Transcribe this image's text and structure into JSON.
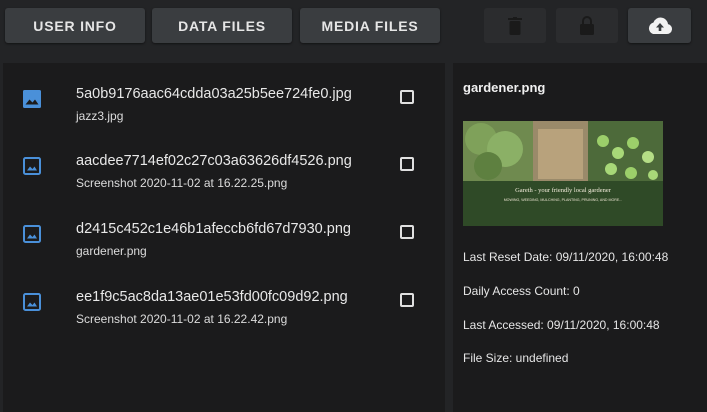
{
  "toolbar": {
    "user_info_label": "USER INFO",
    "data_files_label": "DATA FILES",
    "media_files_label": "MEDIA FILES",
    "delete_icon": "trash-icon",
    "lock_icon": "lock-icon",
    "upload_icon": "cloud-upload-icon"
  },
  "files": [
    {
      "hash": "5a0b9176aac64cdda03a25b5ee724fe0.jpg",
      "name": "jazz3.jpg",
      "icon": "image-icon",
      "icon_style": "filled"
    },
    {
      "hash": "aacdee7714ef02c27c03a63626df4526.png",
      "name": "Screenshot 2020-11-02 at 16.22.25.png",
      "icon": "image-icon",
      "icon_style": "outlined"
    },
    {
      "hash": "d2415c452c1e46b1afeccb6fd67d7930.png",
      "name": "gardener.png",
      "icon": "image-icon",
      "icon_style": "outlined"
    },
    {
      "hash": "ee1f9c5ac8da13ae01e53fd00fc09d92.png",
      "name": "Screenshot 2020-11-02 at 16.22.42.png",
      "icon": "image-icon",
      "icon_style": "outlined"
    }
  ],
  "detail": {
    "title": "gardener.png",
    "preview": {
      "banner_title": "Gareth - your friendly local gardener",
      "banner_subtitle": "MOWING, WEEDING, MULCHING, PLANTING, PRUNING, AND MORE..."
    },
    "last_reset_date": "Last Reset Date: 09/11/2020, 16:00:48",
    "daily_access_count": "Daily Access Count: 0",
    "last_accessed": "Last Accessed: 09/11/2020, 16:00:48",
    "file_size": "File Size: undefined"
  },
  "colors": {
    "icon_blue": "#4a90d9",
    "panel_bg": "#1b1b1c",
    "page_bg": "#232426",
    "button_bg": "#3a3d40"
  }
}
